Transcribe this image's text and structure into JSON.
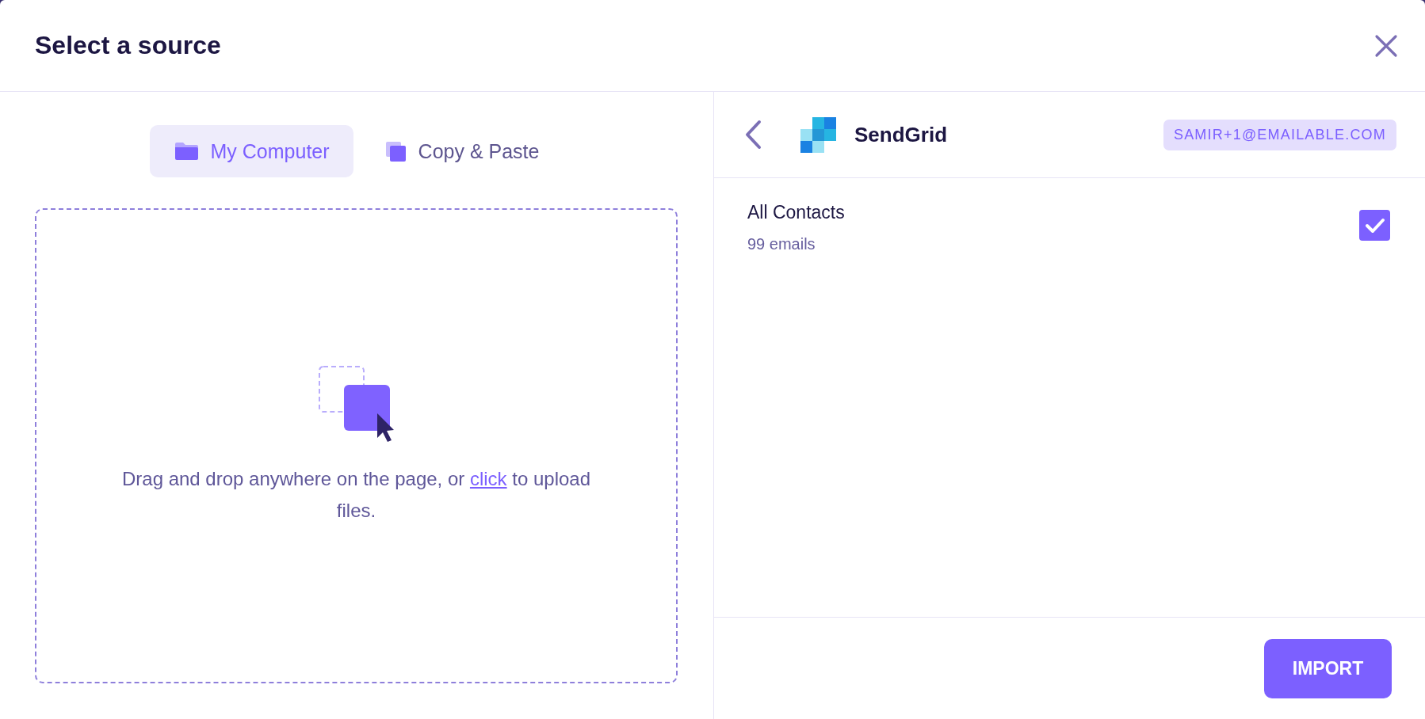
{
  "dialog": {
    "title": "Select a source"
  },
  "source_tabs": [
    {
      "label": "My Computer",
      "selected": true
    },
    {
      "label": "Copy & Paste",
      "selected": false
    }
  ],
  "dropzone": {
    "message_before": "Drag and drop anywhere on the page, or",
    "link": "click",
    "message_after": "to upload files."
  },
  "integration": {
    "name": "SendGrid",
    "account": "SAMIR+1@EMAILABLE.COM"
  },
  "lists": [
    {
      "name": "All Contacts",
      "count": "99 emails",
      "checked": true
    }
  ],
  "footer": {
    "button": "IMPORT"
  }
}
